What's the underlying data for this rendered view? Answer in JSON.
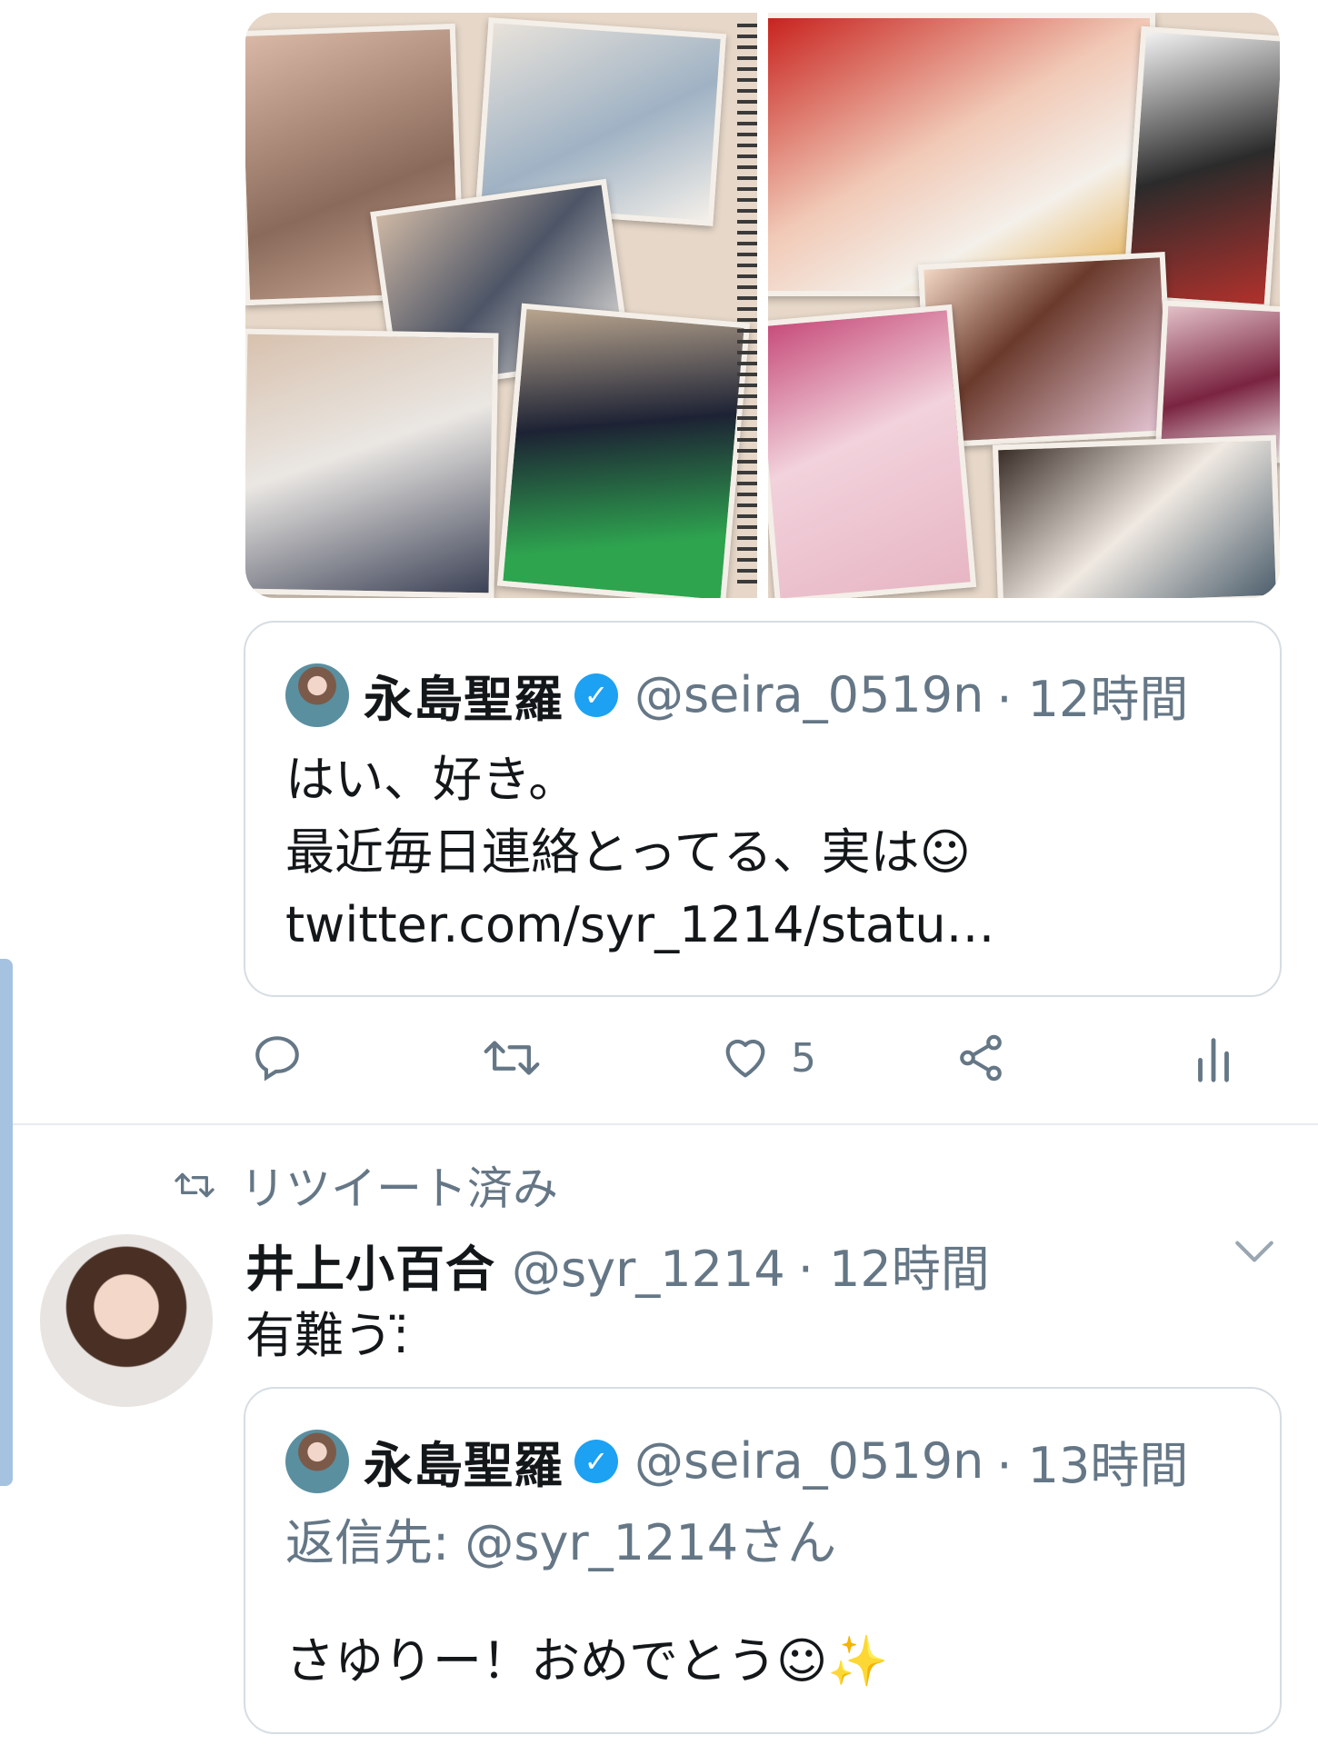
{
  "media": {
    "left_page_label": "",
    "right_page_label": ""
  },
  "quote1": {
    "name": "永島聖羅",
    "handle": "@seira_0519n",
    "time": "· 12時間",
    "text": "はい、好き。\n最近毎日連絡とってる、実は☺\ntwitter.com/syr_1214/statu…"
  },
  "actions": {
    "like_count": "5"
  },
  "retweet": {
    "label": "リツイート済み"
  },
  "tweet2": {
    "name": "井上小百合",
    "handle": "@syr_1214",
    "time": "· 12時間",
    "text": "有難う:̈"
  },
  "quote2": {
    "name": "永島聖羅",
    "handle": "@seira_0519n",
    "time": "· 13時間",
    "reply_to": "返信先: @syr_1214さん",
    "text": "さゆりー！おめでとう☺✨"
  },
  "icons": {
    "verified": "verified-icon",
    "reply": "reply-icon",
    "retweet": "retweet-icon",
    "like": "like-icon",
    "share": "share-icon",
    "analytics": "analytics-icon",
    "chevron": "chevron-down-icon"
  },
  "colors": {
    "accent": "#1da1f2",
    "muted": "#657786",
    "border": "#d6dde3"
  }
}
